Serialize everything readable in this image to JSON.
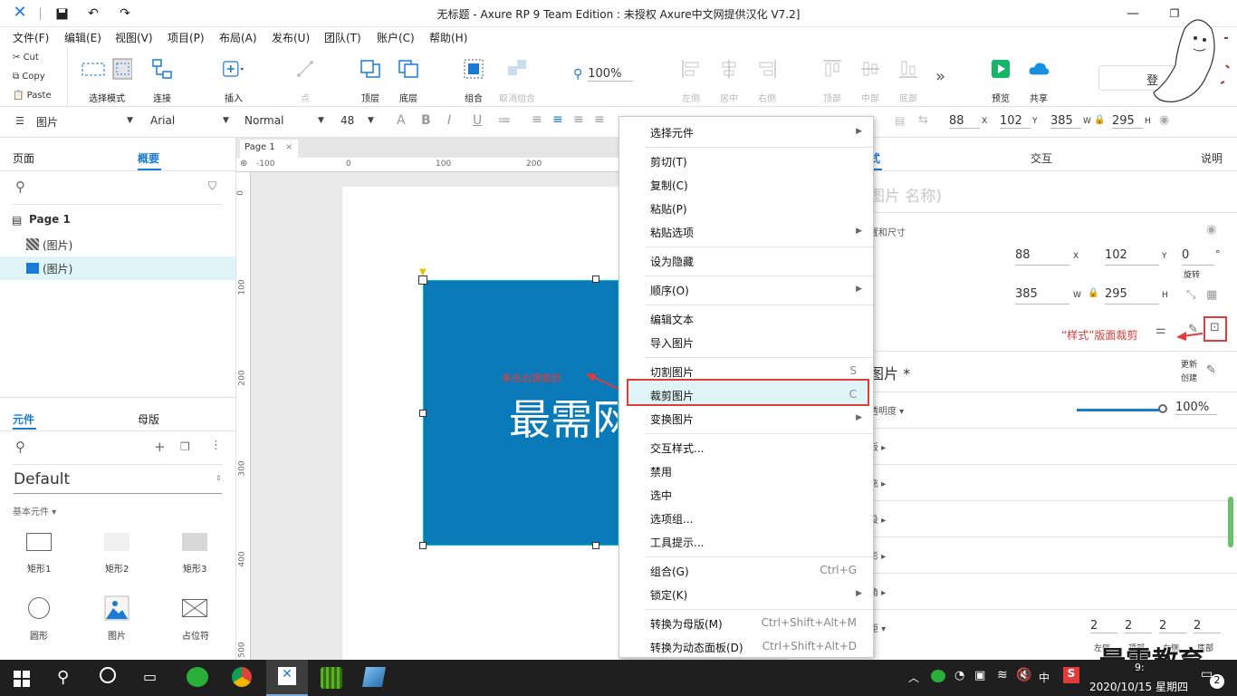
{
  "window": {
    "title": "无标题 - Axure RP 9 Team Edition : 未授权    Axure中文网提供汉化 V7.2]"
  },
  "menu": [
    "文件(F)",
    "编辑(E)",
    "视图(V)",
    "项目(P)",
    "布局(A)",
    "发布(U)",
    "团队(T)",
    "账户(C)",
    "帮助(H)"
  ],
  "clipboard": {
    "cut": "Cut",
    "copy": "Copy",
    "paste": "Paste"
  },
  "toolbar": {
    "select_mode": "选择模式",
    "connect": "连接",
    "insert": "插入",
    "point": "点",
    "top": "顶层",
    "bottom": "底层",
    "group": "组合",
    "ungroup": "取消组合",
    "zoom": "100%",
    "align_left": "左侧",
    "align_center": "居中",
    "align_right": "右侧",
    "align_top": "顶部",
    "align_middle": "中部",
    "align_bottom": "底部",
    "preview": "预览",
    "share": "共享",
    "login": "登"
  },
  "format": {
    "style": "图片",
    "font": "Arial",
    "weight": "Normal",
    "size": "48",
    "x": "88",
    "y": "102",
    "w": "385",
    "h": "295",
    "x_lbl": "X",
    "y_lbl": "Y",
    "w_lbl": "W",
    "h_lbl": "H"
  },
  "left": {
    "tab_pages": "页面",
    "tab_outline": "概要",
    "page_title": "Page 1",
    "items": [
      "(图片)",
      "(图片)"
    ],
    "tab_widgets": "元件",
    "tab_masters": "母版",
    "library": "Default",
    "section": "基本元件 ▾",
    "widgets": [
      "矩形1",
      "矩形2",
      "矩形3",
      "圆形",
      "图片",
      "占位符"
    ]
  },
  "canvas": {
    "tab": "Page 1",
    "ruler_h": [
      "-100",
      "0",
      "100",
      "200"
    ],
    "ruler_v": [
      "0",
      "100",
      "200",
      "300",
      "400",
      "500"
    ],
    "image_text": "最需网",
    "annotation": "单击右键裁剪"
  },
  "context_menu": {
    "items": [
      {
        "label": "选择元件",
        "shortcut": "",
        "arrow": true
      },
      {
        "label": "剪切(T)",
        "shortcut": "",
        "arrow": false
      },
      {
        "label": "复制(C)",
        "shortcut": "",
        "arrow": false
      },
      {
        "label": "粘贴(P)",
        "shortcut": "",
        "arrow": false
      },
      {
        "label": "粘贴选项",
        "shortcut": "",
        "arrow": true
      },
      {
        "label": "设为隐藏",
        "shortcut": "",
        "arrow": false
      },
      {
        "label": "顺序(O)",
        "shortcut": "",
        "arrow": true
      },
      {
        "label": "编辑文本",
        "shortcut": "",
        "arrow": false
      },
      {
        "label": "导入图片",
        "shortcut": "",
        "arrow": false
      },
      {
        "label": "切割图片",
        "shortcut": "S",
        "arrow": false
      },
      {
        "label": "裁剪图片",
        "shortcut": "C",
        "arrow": false
      },
      {
        "label": "变换图片",
        "shortcut": "",
        "arrow": true
      },
      {
        "label": "交互样式...",
        "shortcut": "",
        "arrow": false
      },
      {
        "label": "禁用",
        "shortcut": "",
        "arrow": false
      },
      {
        "label": "选中",
        "shortcut": "",
        "arrow": false
      },
      {
        "label": "选项组...",
        "shortcut": "",
        "arrow": false
      },
      {
        "label": "工具提示...",
        "shortcut": "",
        "arrow": false
      },
      {
        "label": "组合(G)",
        "shortcut": "Ctrl+G",
        "arrow": false
      },
      {
        "label": "锁定(K)",
        "shortcut": "",
        "arrow": true
      },
      {
        "label": "转换为母版(M)",
        "shortcut": "Ctrl+Shift+Alt+M",
        "arrow": false
      },
      {
        "label": "转换为动态面板(D)",
        "shortcut": "Ctrl+Shift+Alt+D",
        "arrow": false
      }
    ]
  },
  "right": {
    "tab_style": "式",
    "tab_interact": "交互",
    "tab_notes": "说明",
    "name_placeholder": "图片 名称)",
    "pos_size": "置和尺寸",
    "x": "88",
    "y": "102",
    "rotation": "0",
    "rot_unit": "°",
    "rot_label": "旋转",
    "w": "385",
    "h": "295",
    "crop_note": "“样式”版面裁剪",
    "image_heading": "图片 *",
    "update": "更新",
    "create": "创建",
    "opacity_label": "透明度 ▾",
    "opacity": "100%",
    "sections": [
      "板 ▸",
      "充 ▸",
      "投 ▸",
      "影 ▸",
      "角 ▸",
      "距 ▾"
    ],
    "padding": [
      "2",
      "2",
      "2",
      "2"
    ],
    "padding_labels": [
      "左侧",
      "顶部",
      "右侧",
      "底部"
    ]
  },
  "watermark": "最需教育",
  "taskbar": {
    "ime": "中",
    "time": "9:",
    "date": "2020/10/15 星期四",
    "notif": "2"
  },
  "colors": {
    "accent": "#1a7bd6",
    "image_fill": "#0a79b8",
    "highlight": "#e03c3c",
    "selected_row": "#dff4f6"
  }
}
